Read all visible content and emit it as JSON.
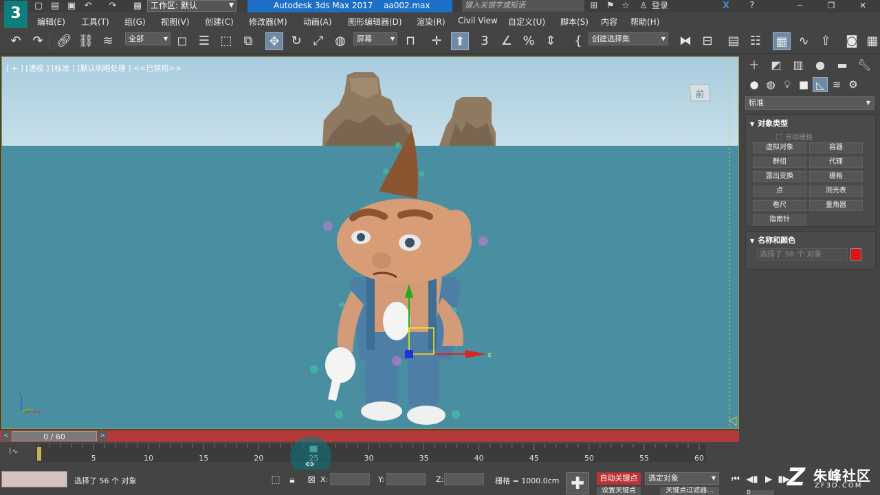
{
  "app": {
    "logo_text": "3",
    "workspace": "工作区: 默认",
    "product": "Autodesk 3ds Max 2017",
    "file": "aa002.max",
    "search_placeholder": "键入关键字或短语",
    "login": "登录"
  },
  "menu": [
    "编辑(E)",
    "工具(T)",
    "组(G)",
    "视图(V)",
    "创建(C)",
    "修改器(M)",
    "动画(A)",
    "图形编辑器(D)",
    "渲染(R)",
    "Civil View",
    "自定义(U)",
    "脚本(S)",
    "内容",
    "帮助(H)"
  ],
  "toolbar": {
    "filter_combo": "全部",
    "coord_combo": "屏幕",
    "named_selection": "创建选择集"
  },
  "viewport": {
    "label": "[ + ] [透视 ] [标准 ] [默认明暗处理 ] <<已禁用>>",
    "viewcube_label": "前",
    "gizmo_axis_x": "x",
    "tripod_x": "x",
    "tripod_y": "y",
    "tripod_z": "z"
  },
  "timeline": {
    "current": "0 / 60",
    "ticks": [
      5,
      10,
      15,
      20,
      25,
      30,
      35,
      40,
      45,
      50,
      55,
      60
    ],
    "start": 0,
    "end": 60,
    "current_frame": 25
  },
  "status": {
    "selection_text": "选择了 56 个 对象",
    "x_label": "X:",
    "y_label": "Y:",
    "z_label": "Z:",
    "grid": "栅格 = 1000.0cm",
    "auto_key": "自动关键点",
    "set_key": "设置关键点",
    "selected_filter": "选定对象",
    "key_filters": "关键点过滤器...",
    "frame_value": "0"
  },
  "watermark": {
    "main": "朱峰社区",
    "sub": "ZF3D.COM",
    "logo": "Z"
  },
  "command_panel": {
    "category": "标准",
    "object_type_title": "对象类型",
    "auto_grid": "自动栅格",
    "buttons": [
      [
        "虚拟对象",
        "容器"
      ],
      [
        "群组",
        "代理"
      ],
      [
        "露出变换",
        "栅格"
      ],
      [
        "点",
        "测光表"
      ],
      [
        "卷尺",
        "量角器"
      ],
      [
        "指南针",
        ""
      ]
    ],
    "name_color_title": "名称和颜色",
    "name_value": "选择了 56 个 对象",
    "color": "#e21212"
  },
  "colors": {
    "autokey_red": "#bb3333",
    "timeslider_red": "#b43a3a",
    "title_blue": "#1b6fc7",
    "accent": "#0e7d7b"
  }
}
